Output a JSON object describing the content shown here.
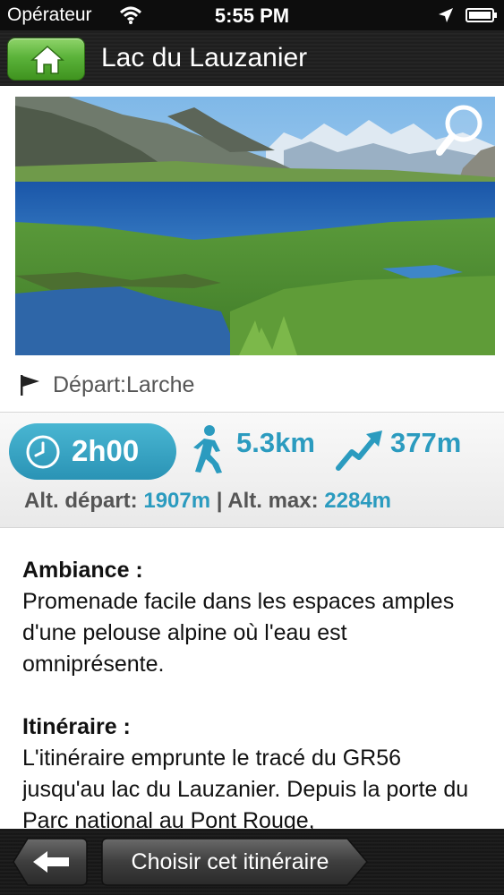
{
  "status_bar": {
    "carrier": "Opérateur",
    "time": "5:55 PM"
  },
  "nav": {
    "title": "Lac du Lauzanier",
    "home_icon": "home-icon"
  },
  "photo": {
    "zoom_icon": "magnifier-icon"
  },
  "departure": {
    "label": "Départ:Larche"
  },
  "stats": {
    "duration": "2h00",
    "distance": "5.3km",
    "elevation_gain": "377m",
    "alt_depart_label": "Alt. départ:",
    "alt_depart_value": "1907m",
    "separator": "|",
    "alt_max_label": "Alt. max:",
    "alt_max_value": "2284m",
    "accent_color": "#2b9bbf"
  },
  "content": {
    "sections": [
      {
        "heading": "Ambiance :",
        "text": "Promenade facile dans les espaces amples d'une pelouse alpine où l'eau est omniprésente."
      },
      {
        "heading": "Itinéraire :",
        "text": "L'itinéraire emprunte le tracé du GR56 jusqu'au lac du Lauzanier. Depuis la porte du Parc national au Pont Rouge,"
      }
    ]
  },
  "toolbar": {
    "choose_label": "Choisir cet itinéraire"
  }
}
